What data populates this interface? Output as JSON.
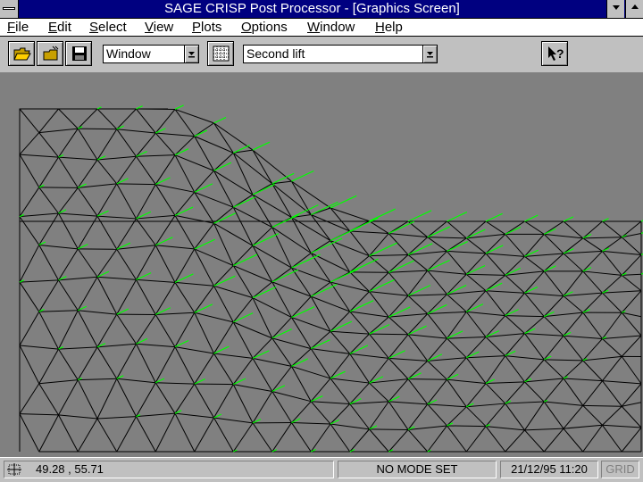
{
  "window": {
    "title": "SAGE CRISP Post Processor - [Graphics Screen]"
  },
  "menu": [
    {
      "label": "File",
      "mnemonic": "F",
      "rest": "ile"
    },
    {
      "label": "Edit",
      "mnemonic": "E",
      "rest": "dit"
    },
    {
      "label": "Select",
      "mnemonic": "S",
      "rest": "elect"
    },
    {
      "label": "View",
      "mnemonic": "V",
      "rest": "iew"
    },
    {
      "label": "Plots",
      "mnemonic": "P",
      "rest": "lots"
    },
    {
      "label": "Options",
      "mnemonic": "O",
      "rest": "ptions"
    },
    {
      "label": "Window",
      "mnemonic": "W",
      "rest": "indow"
    },
    {
      "label": "Help",
      "mnemonic": "H",
      "rest": "elp"
    }
  ],
  "toolbar": {
    "view_select": "Window",
    "stage_select": "Second lift",
    "icons": [
      "open-folder-icon",
      "open-file-icon",
      "save-disk-icon",
      "grid-icon",
      "context-help-icon"
    ]
  },
  "canvas": {
    "background": "#808080",
    "mesh_color": "#000000",
    "vector_color": "#00ff00",
    "content": "finite element mesh with displacement vectors"
  },
  "status": {
    "coords": "49.28 , 55.71",
    "mode": "NO MODE SET",
    "datetime": "21/12/95 11:20",
    "grid": "GRID"
  }
}
